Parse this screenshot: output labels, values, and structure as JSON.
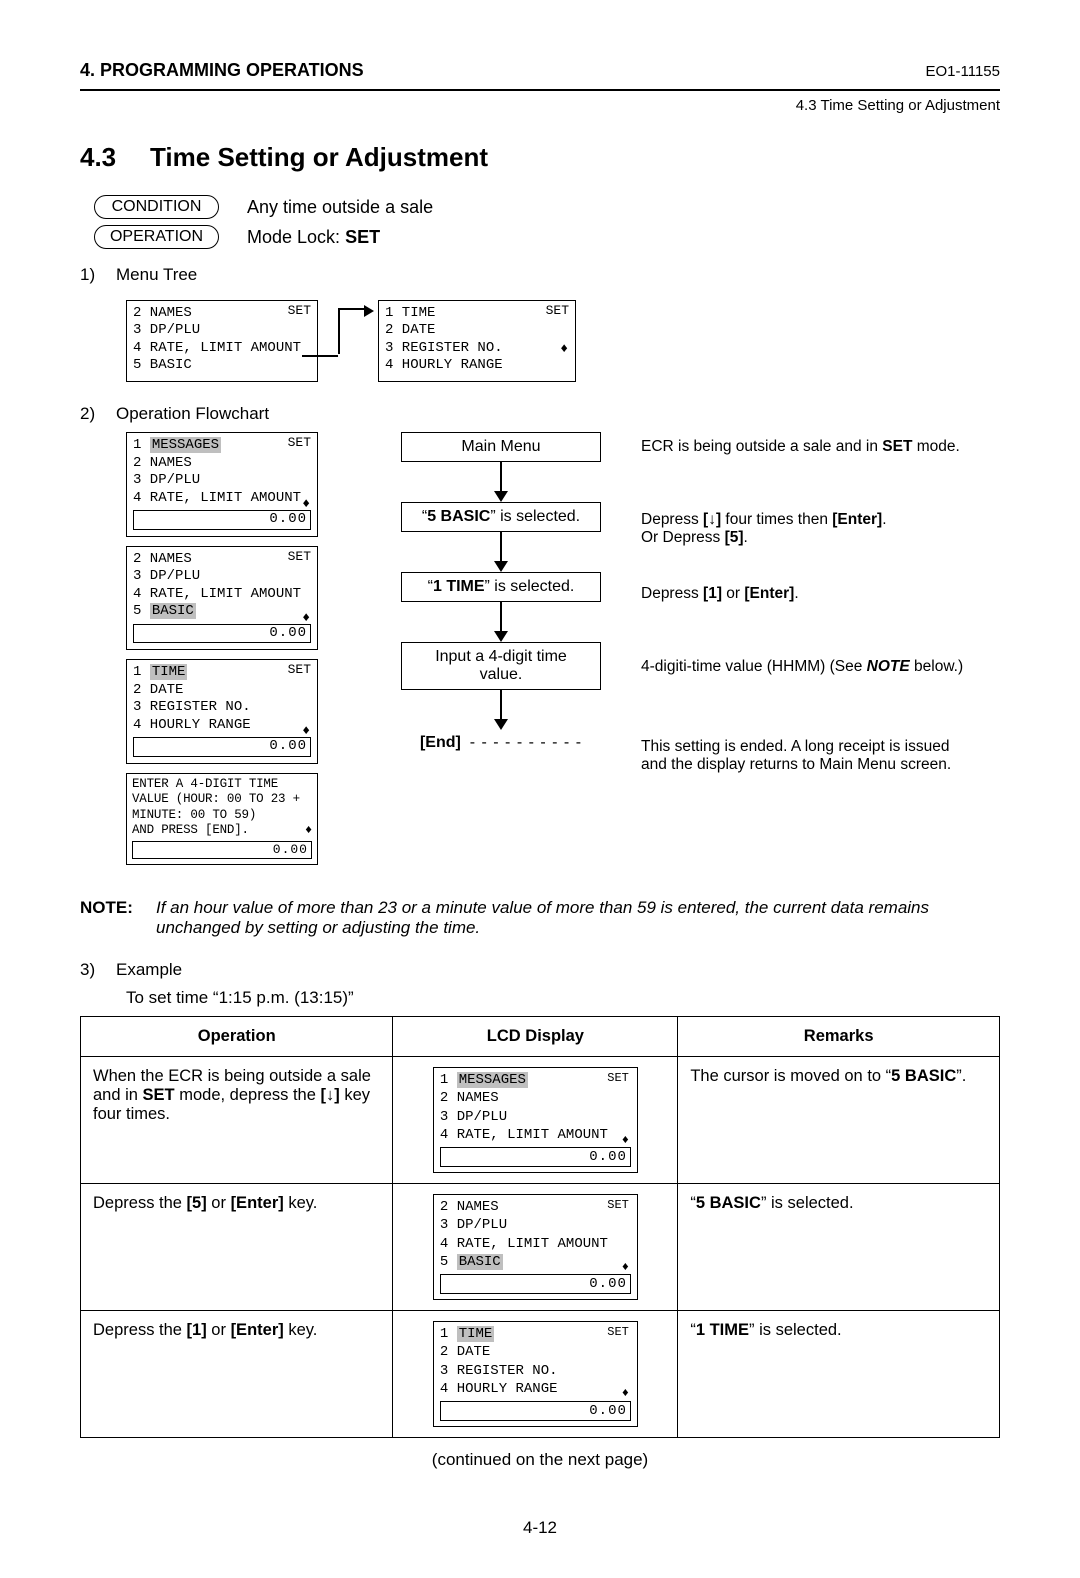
{
  "header": {
    "left": "4. PROGRAMMING OPERATIONS",
    "right": "EO1-11155",
    "sub": "4.3 Time Setting or Adjustment"
  },
  "title": {
    "num": "4.3",
    "text": "Time Setting or Adjustment"
  },
  "condition": {
    "label": "CONDITION",
    "text": "Any time outside a sale"
  },
  "operation": {
    "label": "OPERATION",
    "text_pre": "Mode Lock: ",
    "text_bold": "SET"
  },
  "sec1": {
    "n": "1)",
    "label": "Menu Tree"
  },
  "menutree": {
    "left": {
      "set": "SET",
      "lines": [
        "2 NAMES",
        "3 DP/PLU",
        "4 RATE, LIMIT AMOUNT",
        "5 BASIC"
      ]
    },
    "right": {
      "set": "SET",
      "lines": [
        "1 TIME",
        "2 DATE",
        "3 REGISTER NO.",
        "4 HOURLY RANGE"
      ],
      "updn": "♦"
    }
  },
  "sec2": {
    "n": "2)",
    "label": "Operation Flowchart"
  },
  "flow": {
    "lcd1": {
      "set": "SET",
      "hl": "MESSAGES",
      "l1": "1 ",
      "l2": "2 NAMES",
      "l3": "3 DP/PLU",
      "l4": "4 RATE, LIMIT AMOUNT",
      "updn": "♦",
      "foot": "0.00"
    },
    "lcd2": {
      "set": "SET",
      "l1": "2 NAMES",
      "l2": "3 DP/PLU",
      "l3": "4 RATE, LIMIT AMOUNT",
      "l4pre": "5 ",
      "hl": "BASIC",
      "updn": "♦",
      "foot": "0.00"
    },
    "lcd3": {
      "set": "SET",
      "hl": "TIME",
      "l1": "1 ",
      "l2": "2 DATE",
      "l3": "3 REGISTER NO.",
      "l4": "4 HOURLY RANGE",
      "updn": "♦",
      "foot": "0.00"
    },
    "prompt": {
      "l1": "ENTER A 4-DIGIT TIME",
      "l2": "VALUE (HOUR: 00 TO 23 +",
      "l3": "MINUTE: 00 TO 59)",
      "l4": "AND PRESS [END].",
      "updn": "♦",
      "foot": "0.00"
    },
    "boxes": {
      "main": "Main Menu",
      "basic_pre": "“",
      "basic_b": "5 BASIC",
      "basic_post": "” is selected.",
      "time_pre": "“",
      "time_b": "1 TIME",
      "time_post": "” is selected.",
      "input1": "Input a 4-digit time",
      "input2": "value.",
      "end": "[End]"
    },
    "right": {
      "r1_pre": "ECR is being outside a sale and in ",
      "r1_b": "SET",
      "r1_post": " mode.",
      "r2a_pre": "Depress ",
      "r2a_b1": "[↓]",
      "r2a_mid": " four times then ",
      "r2a_b2": "[Enter]",
      "r2a_post": ".",
      "r2b_pre": "Or Depress ",
      "r2b_b": "[5]",
      "r2b_post": ".",
      "r3_pre": "Depress ",
      "r3_b1": "[1]",
      "r3_mid": " or ",
      "r3_b2": "[Enter]",
      "r3_post": ".",
      "r4_pre": "4-digiti-time value (HHMM) (See ",
      "r4_b": "NOTE",
      "r4_post": " below.)",
      "r5a": "This setting is ended.  A long receipt is issued",
      "r5b": "and the display returns to Main Menu screen."
    },
    "dash": "- - - - - - - - - -"
  },
  "note": {
    "lbl": "NOTE:",
    "text1": "If an hour value of more than 23 or a minute value of more than 59 is entered, the current data remains",
    "text2": "unchanged by setting or adjusting the time."
  },
  "sec3": {
    "n": "3)",
    "label": "Example",
    "sub": "To set time “1:15 p.m. (13:15)”"
  },
  "table": {
    "h1": "Operation",
    "h2": "LCD Display",
    "h3": "Remarks",
    "r1_op_a": "When the ECR is being outside a sale",
    "r1_op_b": "and in ",
    "r1_op_bb": "SET",
    "r1_op_c": " mode, depress the ",
    "r1_op_cb": "[↓]",
    "r1_op_d": " key",
    "r1_op_e": "four times.",
    "r1_rm_a": "The cursor is moved on to “",
    "r1_rm_b": "5 BASIC",
    "r1_rm_c": "”.",
    "r2_op_a": "Depress the ",
    "r2_op_b": "[5]",
    "r2_op_c": " or ",
    "r2_op_d": "[Enter]",
    "r2_op_e": " key.",
    "r2_rm_a": "“",
    "r2_rm_b": "5 BASIC",
    "r2_rm_c": "” is selected.",
    "r3_op_a": "Depress the ",
    "r3_op_b": "[1]",
    "r3_op_c": " or ",
    "r3_op_d": "[Enter]",
    "r3_op_e": " key.",
    "r3_rm_a": "“",
    "r3_rm_b": "1 TIME",
    "r3_rm_c": "” is selected."
  },
  "cont": "(continued on the next page)",
  "page": "4-12"
}
